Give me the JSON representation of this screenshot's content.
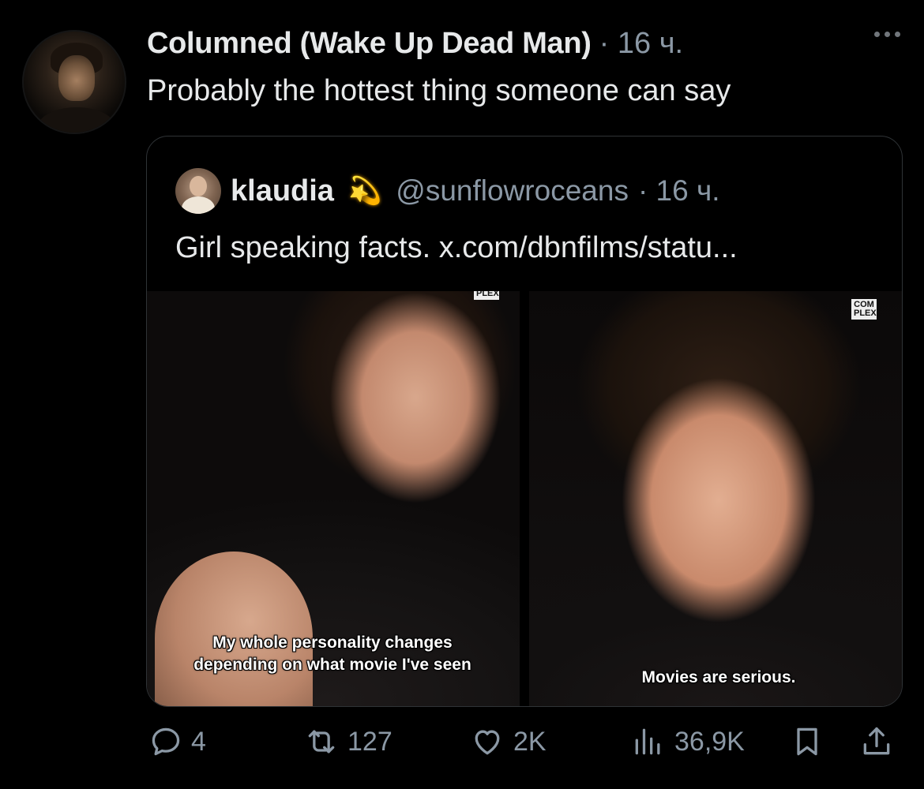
{
  "post": {
    "author_name": "Columned (Wake Up Dead Man)",
    "time": "· 16 ч.",
    "text": "Probably the hottest thing someone can say"
  },
  "quote": {
    "name": "klaudia",
    "emoji": "💫",
    "handle": "@sunflowroceans",
    "time": "· 16 ч.",
    "text": "Girl speaking facts. x.com/dbnfilms/statu...",
    "media": {
      "left_caption": "My whole personality changes depending on what movie I've seen",
      "right_caption": "Movies are serious.",
      "left_watermark": "PLEX",
      "right_watermark": "COM PLEX"
    }
  },
  "actions": {
    "replies": "4",
    "reposts": "127",
    "likes": "2K",
    "views": "36,9K"
  },
  "icons": {
    "more": "more-horizontal-icon",
    "reply": "reply-icon",
    "repost": "repost-icon",
    "like": "heart-icon",
    "views": "views-chart-icon",
    "bookmark": "bookmark-icon",
    "share": "share-icon"
  },
  "colors": {
    "background": "#000000",
    "text_primary": "#e7e9ea",
    "text_secondary": "#8b98a5",
    "border": "#2f3336"
  }
}
